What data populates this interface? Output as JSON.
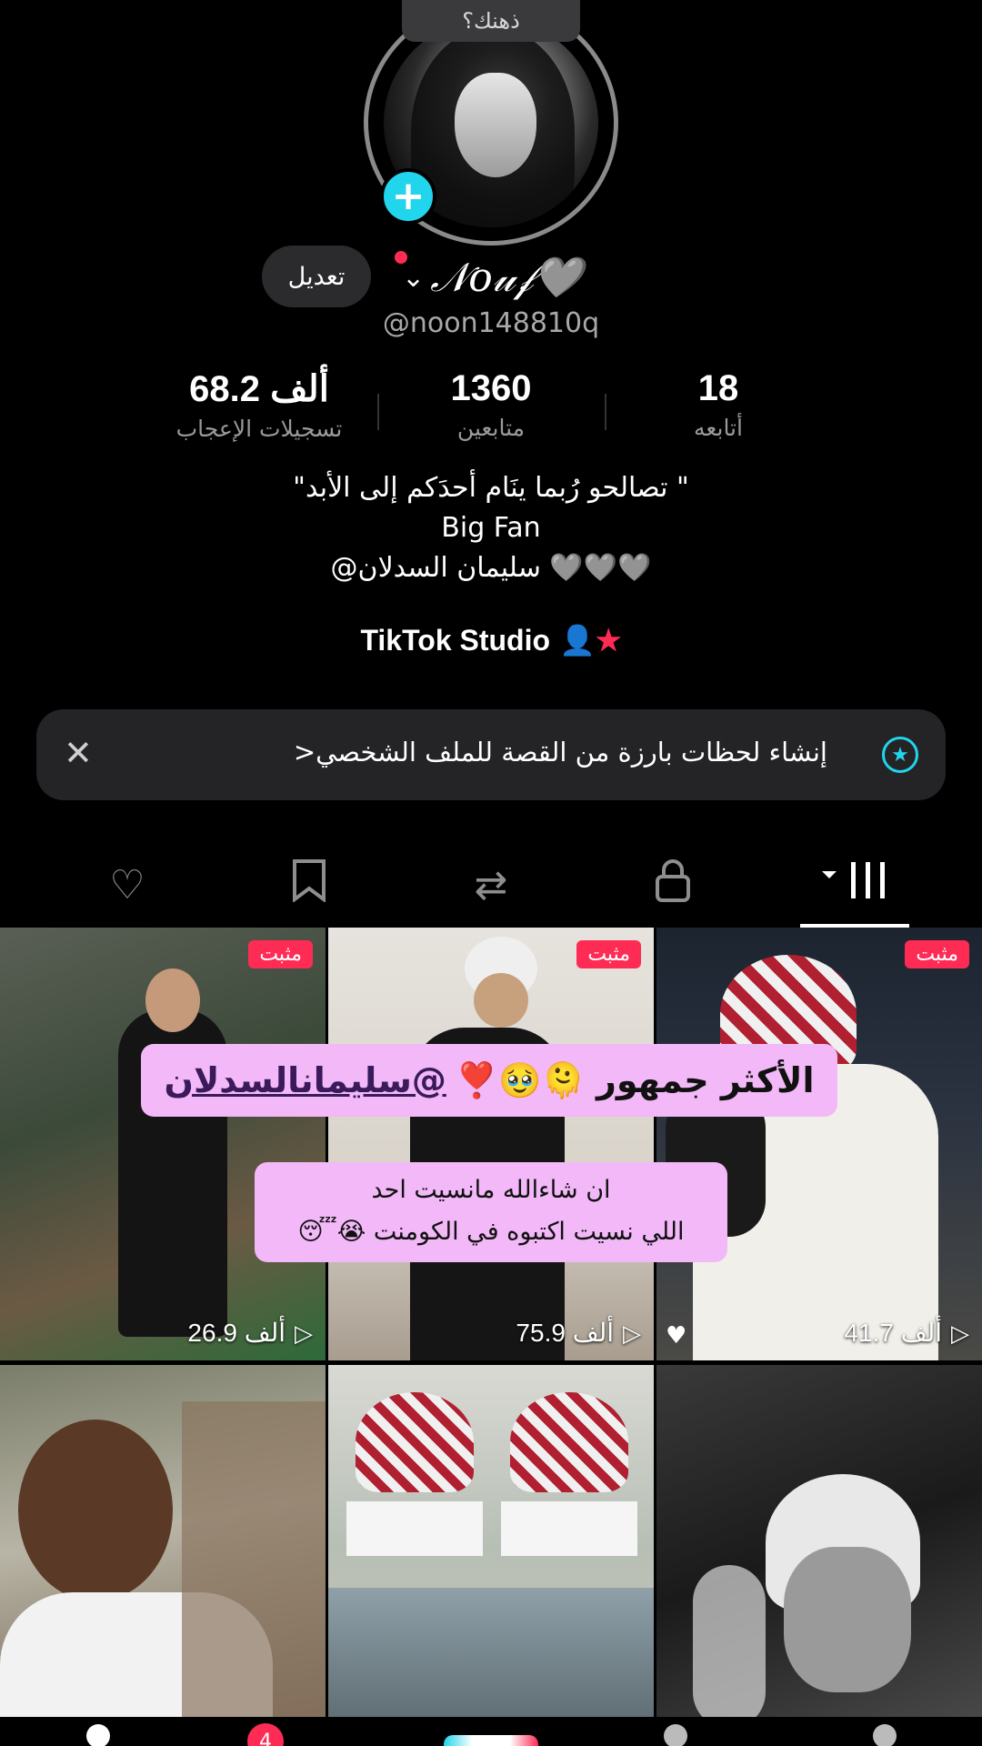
{
  "header": {
    "note_bubble": "ذهنك؟"
  },
  "profile": {
    "name": "𝒩𝑜𝓊𝒻🩶",
    "handle": "@noon148810q",
    "edit_label": "تعديل"
  },
  "stats": [
    {
      "value": "68.2 ألف",
      "label": "تسجيلات الإعجاب"
    },
    {
      "value": "1360",
      "label": "متابعين"
    },
    {
      "value": "18",
      "label": "أتابعه"
    }
  ],
  "bio": {
    "line1": "\"تصالحو رُبما ينَام أحدَكم إلى الأبد \"",
    "line2": "Big Fan",
    "line3": "@سليمان السدلان 🩶🩶🩶"
  },
  "studio_label": "TikTok Studio",
  "banner": {
    "text": "إنشاء لحظات بارزة من القصة للملف الشخصي<",
    "close": "✕"
  },
  "tabs": [
    {
      "name": "liked",
      "icon": "♡"
    },
    {
      "name": "saved",
      "icon": "🔖"
    },
    {
      "name": "reposts",
      "icon": "⇄"
    },
    {
      "name": "private",
      "icon": "🔒"
    },
    {
      "name": "videos",
      "icon": "▾ |||"
    }
  ],
  "videos": [
    {
      "pinned": "مثبت",
      "views": "26.9 ألف"
    },
    {
      "pinned": "مثبت",
      "views": "75.9 ألف"
    },
    {
      "pinned": "مثبت",
      "views": "41.7 ألف"
    }
  ],
  "stickers": {
    "main": "الأكثر جمهور 🫠🥹❣️",
    "mention": "@سليمانالسدلان",
    "secondary_line1": "ان شاءالله مانسيت احد",
    "secondary_line2": "اللي نسيت اكتبوه في الكومنت 😭😴"
  },
  "nav": {
    "inbox_badge": "4"
  }
}
